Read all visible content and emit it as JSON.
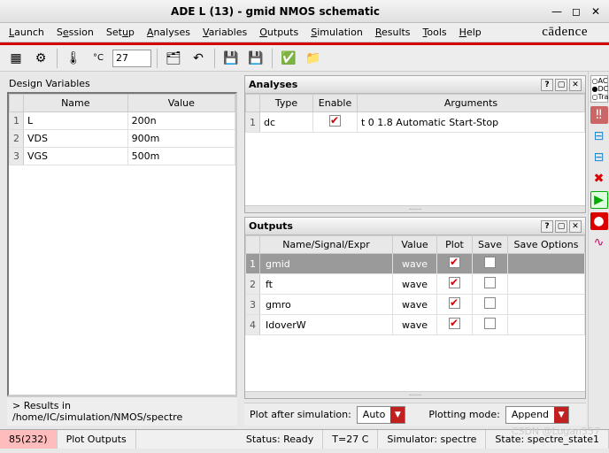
{
  "window": {
    "title": "ADE L (13) - gmid NMOS schematic"
  },
  "menu": [
    "Launch",
    "Session",
    "Setup",
    "Analyses",
    "Variables",
    "Outputs",
    "Simulation",
    "Results",
    "Tools",
    "Help"
  ],
  "brand": "cādence",
  "temperature": "27",
  "designVars": {
    "title": "Design Variables",
    "cols": [
      "Name",
      "Value"
    ],
    "rows": [
      {
        "n": "1",
        "name": "L",
        "value": "200n"
      },
      {
        "n": "2",
        "name": "VDS",
        "value": "900m"
      },
      {
        "n": "3",
        "name": "VGS",
        "value": "500m"
      }
    ]
  },
  "analyses": {
    "title": "Analyses",
    "cols": [
      "Type",
      "Enable",
      "Arguments"
    ],
    "rows": [
      {
        "n": "1",
        "type": "dc",
        "enable": true,
        "args": "t 0 1.8 Automatic Start-Stop"
      }
    ]
  },
  "outputs": {
    "title": "Outputs",
    "cols": [
      "Name/Signal/Expr",
      "Value",
      "Plot",
      "Save",
      "Save Options"
    ],
    "rows": [
      {
        "n": "1",
        "name": "gmid",
        "value": "wave",
        "plot": true,
        "save": false,
        "sel": true
      },
      {
        "n": "2",
        "name": "ft",
        "value": "wave",
        "plot": true,
        "save": false
      },
      {
        "n": "3",
        "name": "gmro",
        "value": "wave",
        "plot": true,
        "save": false
      },
      {
        "n": "4",
        "name": "IdoverW",
        "value": "wave",
        "plot": true,
        "save": false
      }
    ]
  },
  "footer": {
    "plotAfterLabel": "Plot after simulation:",
    "plotAfterValue": "Auto",
    "plotModeLabel": "Plotting mode:",
    "plotModeValue": "Append"
  },
  "resultsPath": "> Results in /home/IC/simulation/NMOS/spectre",
  "status": {
    "sel": "85(232)",
    "mouse": "Plot Outputs",
    "ready": "Status: Ready",
    "temp": "T=27 C",
    "sim": "Simulator: spectre",
    "state": "State: spectre_state1"
  },
  "modes": "○AC\n●DC\n○Trans",
  "watermark": "CSDN @Logan557"
}
